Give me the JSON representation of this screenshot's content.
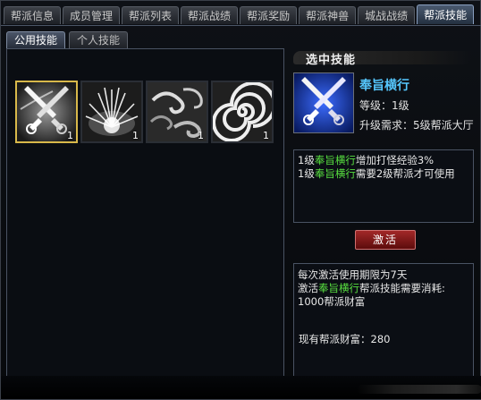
{
  "tabs": [
    "帮派信息",
    "成员管理",
    "帮派列表",
    "帮派战绩",
    "帮派奖励",
    "帮派神兽",
    "城战战绩",
    "帮派技能"
  ],
  "active_tab_index": 7,
  "sub_tabs": [
    "公用技能",
    "个人技能"
  ],
  "active_sub_tab_index": 0,
  "skills": [
    {
      "icon": "crossed-swords-icon",
      "count": "1",
      "selected": true
    },
    {
      "icon": "burst-icon",
      "count": "1",
      "selected": false
    },
    {
      "icon": "wind-swirl-icon",
      "count": "1",
      "selected": false
    },
    {
      "icon": "spiral-icon",
      "count": "1",
      "selected": false
    }
  ],
  "selected": {
    "header": "选中技能",
    "icon": "crossed-swords-icon",
    "name": "奉旨横行",
    "level": "等级：1级",
    "requirement": "升级需求：5级帮派大厅"
  },
  "description": {
    "line1_prefix": "1级",
    "line1_name": "奉旨横行",
    "line1_suffix": "增加打怪经验3%",
    "line2_prefix": "1级",
    "line2_name": "奉旨横行",
    "line2_suffix": "需要2级帮派才可使用"
  },
  "activate_label": "激活",
  "info": {
    "line1": "每次激活使用期限为7天",
    "line2_prefix": "激活",
    "line2_name": "奉旨横行",
    "line2_suffix": "帮派技能需要消耗:",
    "line3": "1000帮派财富",
    "wealth": "现有帮派财富：280"
  },
  "colors": {
    "accent_blue": "#56c8ff",
    "skill_name_green": "#58e040",
    "selected_border": "#d8b84a",
    "button_red": "#a22828"
  }
}
